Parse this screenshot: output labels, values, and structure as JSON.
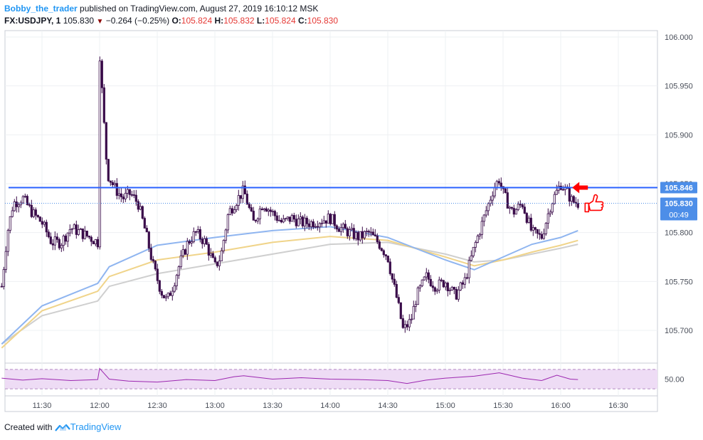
{
  "header": {
    "author": "Bobby_the_trader",
    "published": "published on TradingView.com, August 27, 2019 16:10:12 MSK",
    "symbol": "FX:USDJPY, 1",
    "last": "105.830",
    "change_arrow": "▼",
    "change": "−0.264 (−0.25%)",
    "open_label": "O:",
    "open": "105.824",
    "high_label": "H:",
    "high": "105.832",
    "low_label": "L:",
    "low": "105.824",
    "close_label": "C:",
    "close": "105.830"
  },
  "footer": {
    "created_with": "Created with",
    "brand": "TradingView"
  },
  "colors": {
    "candle": "#3a0c4a",
    "hline": "#2962ff",
    "ema_fast": "#8fb5f0",
    "ema_mid": "#f0d48a",
    "ema_slow": "#cfcfcf",
    "rsi": "#9c27b0",
    "rsi_band": "#eedcf5",
    "price_label": "#4d8ee8",
    "arrow": "#ff0000"
  },
  "chart_data": {
    "type": "candlestick",
    "symbol": "FX:USDJPY",
    "interval": "1",
    "x_ticks": [
      "11:30",
      "12:00",
      "12:30",
      "13:00",
      "13:30",
      "14:00",
      "14:30",
      "15:00",
      "15:30",
      "16:00",
      "16:30"
    ],
    "y_ticks": [
      "106.000",
      "105.950",
      "105.900",
      "105.850",
      "105.800",
      "105.750",
      "105.700"
    ],
    "ylim": [
      105.67,
      106.01
    ],
    "horizontal_line": {
      "label": "105.846",
      "value": 105.846
    },
    "last_price": {
      "label": "105.830",
      "value": 105.83,
      "countdown": "00:49"
    },
    "close_path": [
      [
        "11:09",
        105.745
      ],
      [
        "11:12",
        105.8
      ],
      [
        "11:15",
        105.83
      ],
      [
        "11:20",
        105.835
      ],
      [
        "11:25",
        105.82
      ],
      [
        "11:30",
        105.81
      ],
      [
        "11:35",
        105.79
      ],
      [
        "11:40",
        105.79
      ],
      [
        "11:45",
        105.805
      ],
      [
        "11:50",
        105.8
      ],
      [
        "11:55",
        105.795
      ],
      [
        "11:59",
        105.79
      ],
      [
        "12:00",
        105.985
      ],
      [
        "12:02",
        105.92
      ],
      [
        "12:04",
        105.86
      ],
      [
        "12:08",
        105.845
      ],
      [
        "12:12",
        105.835
      ],
      [
        "12:16",
        105.84
      ],
      [
        "12:20",
        105.83
      ],
      [
        "12:24",
        105.8
      ],
      [
        "12:28",
        105.765
      ],
      [
        "12:32",
        105.74
      ],
      [
        "12:35",
        105.73
      ],
      [
        "12:38",
        105.745
      ],
      [
        "12:42",
        105.77
      ],
      [
        "12:46",
        105.79
      ],
      [
        "12:50",
        105.8
      ],
      [
        "12:55",
        105.79
      ],
      [
        "13:00",
        105.765
      ],
      [
        "13:03",
        105.775
      ],
      [
        "13:07",
        105.82
      ],
      [
        "13:12",
        105.835
      ],
      [
        "13:15",
        105.843
      ],
      [
        "13:20",
        105.81
      ],
      [
        "13:25",
        105.83
      ],
      [
        "13:30",
        105.82
      ],
      [
        "13:35",
        105.81
      ],
      [
        "13:40",
        105.815
      ],
      [
        "13:45",
        105.81
      ],
      [
        "13:50",
        105.81
      ],
      [
        "14:00",
        105.815
      ],
      [
        "14:05",
        105.805
      ],
      [
        "14:10",
        105.8
      ],
      [
        "14:15",
        105.795
      ],
      [
        "14:20",
        105.8
      ],
      [
        "14:25",
        105.79
      ],
      [
        "14:30",
        105.775
      ],
      [
        "14:32",
        105.755
      ],
      [
        "14:35",
        105.73
      ],
      [
        "14:38",
        105.7
      ],
      [
        "14:42",
        105.71
      ],
      [
        "14:45",
        105.735
      ],
      [
        "14:50",
        105.755
      ],
      [
        "14:55",
        105.745
      ],
      [
        "15:00",
        105.75
      ],
      [
        "15:05",
        105.735
      ],
      [
        "15:10",
        105.75
      ],
      [
        "15:15",
        105.785
      ],
      [
        "15:20",
        105.815
      ],
      [
        "15:25",
        105.845
      ],
      [
        "15:28",
        105.855
      ],
      [
        "15:30",
        105.84
      ],
      [
        "15:35",
        105.82
      ],
      [
        "15:40",
        105.83
      ],
      [
        "15:45",
        105.8
      ],
      [
        "15:50",
        105.795
      ],
      [
        "15:55",
        105.83
      ],
      [
        "16:00",
        105.85
      ],
      [
        "16:03",
        105.842
      ],
      [
        "16:06",
        105.832
      ],
      [
        "16:09",
        105.83
      ]
    ],
    "indicators": {
      "moving_averages": [
        {
          "points": [
            [
              "11:09",
              105.686
            ],
            [
              "11:30",
              105.725
            ],
            [
              "11:59",
              105.748
            ],
            [
              "12:05",
              105.765
            ],
            [
              "12:30",
              105.787
            ],
            [
              "13:00",
              105.795
            ],
            [
              "13:30",
              105.802
            ],
            [
              "14:00",
              105.806
            ],
            [
              "14:30",
              105.795
            ],
            [
              "15:00",
              105.772
            ],
            [
              "15:15",
              105.762
            ],
            [
              "15:30",
              105.775
            ],
            [
              "15:45",
              105.788
            ],
            [
              "16:00",
              105.795
            ],
            [
              "16:09",
              105.802
            ]
          ]
        },
        {
          "points": [
            [
              "11:09",
              105.682
            ],
            [
              "11:30",
              105.72
            ],
            [
              "11:59",
              105.74
            ],
            [
              "12:05",
              105.755
            ],
            [
              "12:30",
              105.772
            ],
            [
              "13:00",
              105.78
            ],
            [
              "13:30",
              105.79
            ],
            [
              "14:00",
              105.796
            ],
            [
              "14:30",
              105.792
            ],
            [
              "15:00",
              105.775
            ],
            [
              "15:15",
              105.766
            ],
            [
              "15:30",
              105.772
            ],
            [
              "15:45",
              105.78
            ],
            [
              "16:00",
              105.787
            ],
            [
              "16:09",
              105.792
            ]
          ]
        },
        {
          "points": [
            [
              "11:09",
              105.686
            ],
            [
              "11:30",
              105.715
            ],
            [
              "11:59",
              105.73
            ],
            [
              "12:05",
              105.745
            ],
            [
              "12:30",
              105.758
            ],
            [
              "13:00",
              105.768
            ],
            [
              "13:30",
              105.778
            ],
            [
              "14:00",
              105.788
            ],
            [
              "14:30",
              105.79
            ],
            [
              "15:00",
              105.778
            ],
            [
              "15:15",
              105.77
            ],
            [
              "15:30",
              105.772
            ],
            [
              "15:45",
              105.778
            ],
            [
              "16:00",
              105.784
            ],
            [
              "16:09",
              105.788
            ]
          ]
        }
      ],
      "oscillator": {
        "y_tick": "50.00",
        "band": [
          30,
          70
        ],
        "ylim": [
          20,
          80
        ],
        "points": [
          [
            "11:09",
            52
          ],
          [
            "11:20",
            48
          ],
          [
            "11:30",
            51
          ],
          [
            "11:45",
            47
          ],
          [
            "11:59",
            49
          ],
          [
            "12:00",
            72
          ],
          [
            "12:05",
            50
          ],
          [
            "12:15",
            46
          ],
          [
            "12:30",
            44
          ],
          [
            "12:45",
            49
          ],
          [
            "13:00",
            47
          ],
          [
            "13:10",
            55
          ],
          [
            "13:15",
            57
          ],
          [
            "13:30",
            50
          ],
          [
            "13:45",
            53
          ],
          [
            "14:00",
            50
          ],
          [
            "14:15",
            49
          ],
          [
            "14:30",
            47
          ],
          [
            "14:40",
            41
          ],
          [
            "14:50",
            48
          ],
          [
            "15:00",
            52
          ],
          [
            "15:15",
            56
          ],
          [
            "15:28",
            63
          ],
          [
            "15:40",
            52
          ],
          [
            "15:50",
            47
          ],
          [
            "15:58",
            58
          ],
          [
            "16:05",
            50
          ],
          [
            "16:09",
            49
          ]
        ]
      }
    }
  }
}
